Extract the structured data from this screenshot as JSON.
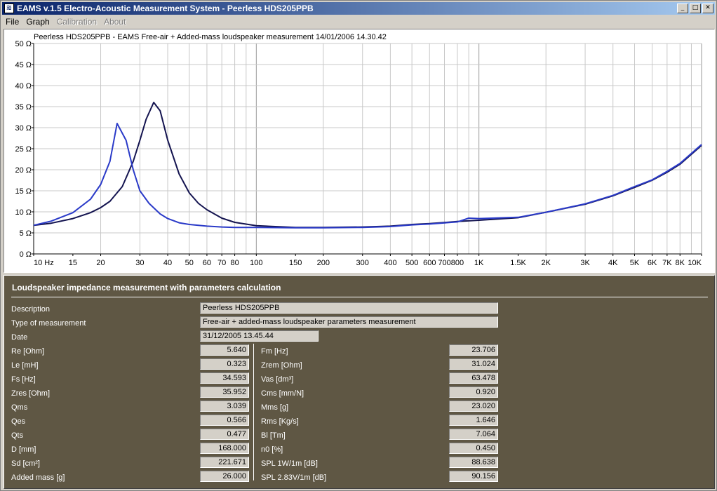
{
  "window": {
    "title": "EAMS v.1.5 Electro-Acoustic Measurement System - Peerless HDS205PPB",
    "icon": "eams-app-icon",
    "buttons": [
      "minimize",
      "maximize",
      "close"
    ]
  },
  "menu": {
    "items": [
      {
        "label": "File",
        "enabled": true
      },
      {
        "label": "Graph",
        "enabled": true
      },
      {
        "label": "Calibration",
        "enabled": false
      },
      {
        "label": "About",
        "enabled": false
      }
    ]
  },
  "chart_data": {
    "type": "line",
    "title": "Peerless HDS205PPB - EAMS Free-air + Added-mass loudspeaker measurement 14/01/2006 14.30.42",
    "xlabel": "",
    "ylabel": "",
    "x_scale": "log",
    "xlim": [
      10,
      10000
    ],
    "ylim": [
      0,
      50
    ],
    "grid": true,
    "x_tick_labels": [
      {
        "v": 10,
        "t": "10 Hz"
      },
      {
        "v": 15,
        "t": "15"
      },
      {
        "v": 20,
        "t": "20"
      },
      {
        "v": 30,
        "t": "30"
      },
      {
        "v": 40,
        "t": "40"
      },
      {
        "v": 50,
        "t": "50"
      },
      {
        "v": 60,
        "t": "60"
      },
      {
        "v": 70,
        "t": "70"
      },
      {
        "v": 80,
        "t": "80"
      },
      {
        "v": 100,
        "t": "100"
      },
      {
        "v": 150,
        "t": "150"
      },
      {
        "v": 200,
        "t": "200"
      },
      {
        "v": 300,
        "t": "300"
      },
      {
        "v": 400,
        "t": "400"
      },
      {
        "v": 500,
        "t": "500"
      },
      {
        "v": 600,
        "t": "600"
      },
      {
        "v": 700,
        "t": "700"
      },
      {
        "v": 800,
        "t": "800"
      },
      {
        "v": 1000,
        "t": "1K"
      },
      {
        "v": 1500,
        "t": "1.5K"
      },
      {
        "v": 2000,
        "t": "2K"
      },
      {
        "v": 3000,
        "t": "3K"
      },
      {
        "v": 4000,
        "t": "4K"
      },
      {
        "v": 5000,
        "t": "5K"
      },
      {
        "v": 6000,
        "t": "6K"
      },
      {
        "v": 7000,
        "t": "7K"
      },
      {
        "v": 8000,
        "t": "8K"
      },
      {
        "v": 10000,
        "t": "10K"
      }
    ],
    "y_tick_labels": [
      {
        "v": 0,
        "t": "0 Ω"
      },
      {
        "v": 5,
        "t": "5 Ω"
      },
      {
        "v": 10,
        "t": "10 Ω"
      },
      {
        "v": 15,
        "t": "15 Ω"
      },
      {
        "v": 20,
        "t": "20 Ω"
      },
      {
        "v": 25,
        "t": "25 Ω"
      },
      {
        "v": 30,
        "t": "30 Ω"
      },
      {
        "v": 35,
        "t": "35 Ω"
      },
      {
        "v": 40,
        "t": "40 Ω"
      },
      {
        "v": 45,
        "t": "45 Ω"
      },
      {
        "v": 50,
        "t": "50 Ω"
      }
    ],
    "series": [
      {
        "color": "#141450",
        "points": [
          [
            10,
            6.8
          ],
          [
            12,
            7.3
          ],
          [
            15,
            8.4
          ],
          [
            18,
            9.8
          ],
          [
            20,
            11
          ],
          [
            22,
            12.5
          ],
          [
            25,
            16
          ],
          [
            28,
            22
          ],
          [
            30,
            27
          ],
          [
            32,
            32
          ],
          [
            34.6,
            36
          ],
          [
            37,
            34
          ],
          [
            40,
            27
          ],
          [
            45,
            19
          ],
          [
            50,
            14.5
          ],
          [
            55,
            12
          ],
          [
            60,
            10.5
          ],
          [
            70,
            8.5
          ],
          [
            80,
            7.5
          ],
          [
            100,
            6.7
          ],
          [
            150,
            6.3
          ],
          [
            200,
            6.3
          ],
          [
            300,
            6.4
          ],
          [
            400,
            6.6
          ],
          [
            500,
            7.0
          ],
          [
            600,
            7.2
          ],
          [
            800,
            7.7
          ],
          [
            1000,
            8.0
          ],
          [
            1500,
            8.6
          ],
          [
            2000,
            9.9
          ],
          [
            3000,
            11.8
          ],
          [
            4000,
            13.8
          ],
          [
            5000,
            15.8
          ],
          [
            6000,
            17.5
          ],
          [
            7000,
            19.4
          ],
          [
            8000,
            21.3
          ],
          [
            10000,
            25.8
          ]
        ]
      },
      {
        "color": "#2a3ac8",
        "points": [
          [
            10,
            6.8
          ],
          [
            12,
            7.8
          ],
          [
            15,
            9.8
          ],
          [
            18,
            13
          ],
          [
            20,
            16.5
          ],
          [
            22,
            22
          ],
          [
            23.7,
            31
          ],
          [
            26,
            27
          ],
          [
            28,
            20
          ],
          [
            30,
            15
          ],
          [
            33,
            12
          ],
          [
            37,
            9.5
          ],
          [
            40,
            8.4
          ],
          [
            45,
            7.4
          ],
          [
            50,
            7.0
          ],
          [
            60,
            6.6
          ],
          [
            70,
            6.4
          ],
          [
            80,
            6.3
          ],
          [
            100,
            6.3
          ],
          [
            150,
            6.2
          ],
          [
            200,
            6.2
          ],
          [
            300,
            6.3
          ],
          [
            400,
            6.5
          ],
          [
            500,
            6.9
          ],
          [
            600,
            7.1
          ],
          [
            800,
            7.6
          ],
          [
            900,
            8.5
          ],
          [
            1000,
            8.4
          ],
          [
            1500,
            8.7
          ],
          [
            2000,
            9.9
          ],
          [
            3000,
            11.9
          ],
          [
            4000,
            13.9
          ],
          [
            5000,
            16
          ],
          [
            6000,
            17.6
          ],
          [
            7000,
            19.6
          ],
          [
            8000,
            21.5
          ],
          [
            10000,
            26
          ]
        ]
      }
    ]
  },
  "panel": {
    "title": "Loudspeaker impedance measurement with parameters calculation",
    "description_label": "Description",
    "description_value": "Peerless HDS205PPB",
    "type_label": "Type of measurement",
    "type_value": "Free-air + added-mass loudspeaker parameters measurement",
    "date_label": "Date",
    "date_value": "31/12/2005 13.45.44",
    "left_params": [
      {
        "label": "Re [Ohm]",
        "value": "5.640"
      },
      {
        "label": "Le [mH]",
        "value": "0.323"
      },
      {
        "label": "Fs [Hz]",
        "value": "34.593"
      },
      {
        "label": "Zres [Ohm]",
        "value": "35.952"
      },
      {
        "label": "Qms",
        "value": "3.039"
      },
      {
        "label": "Qes",
        "value": "0.566"
      },
      {
        "label": "Qts",
        "value": "0.477"
      },
      {
        "label": "D [mm]",
        "value": "168.000"
      },
      {
        "label": "Sd [cm²]",
        "value": "221.671"
      },
      {
        "label": "Added mass [g]",
        "value": "26.000"
      }
    ],
    "right_params": [
      {
        "label": "Fm [Hz]",
        "value": "23.706"
      },
      {
        "label": "Zrem [Ohm]",
        "value": "31.024"
      },
      {
        "label": "Vas [dm³]",
        "value": "63.478"
      },
      {
        "label": "Cms [mm/N]",
        "value": "0.920"
      },
      {
        "label": "Mms [g]",
        "value": "23.020"
      },
      {
        "label": "Rms [Kg/s]",
        "value": "1.646"
      },
      {
        "label": "Bl [Tm]",
        "value": "7.064"
      },
      {
        "label": "n0 [%]",
        "value": "0.450"
      },
      {
        "label": "SPL 1W/1m [dB]",
        "value": "88.638"
      },
      {
        "label": "SPL 2.83V/1m [dB]",
        "value": "90.156"
      }
    ]
  }
}
